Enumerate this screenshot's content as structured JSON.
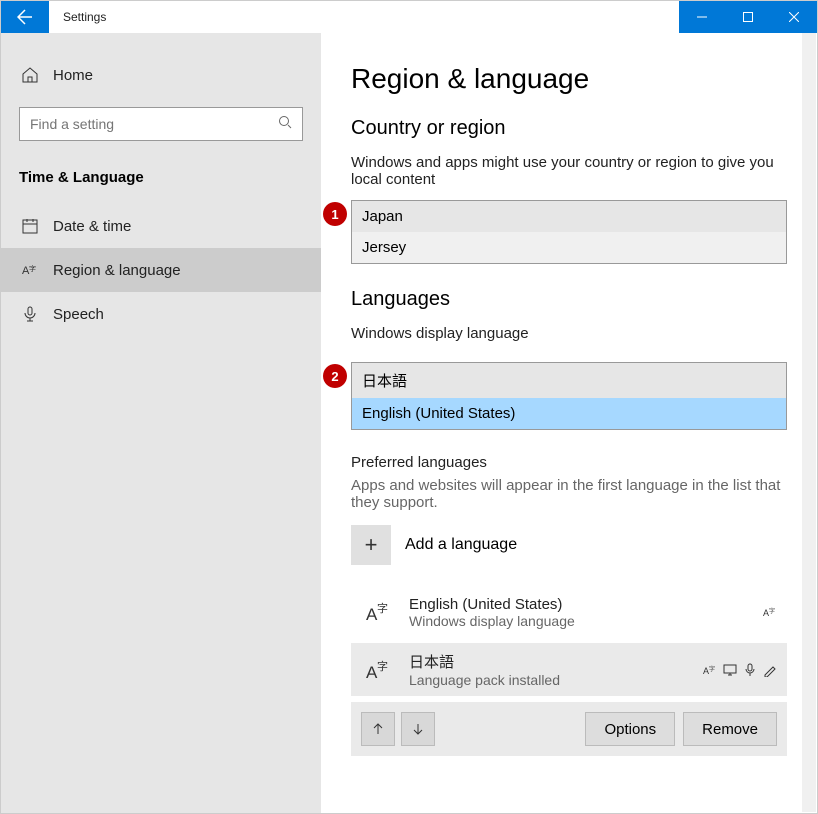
{
  "titlebar": {
    "title": "Settings"
  },
  "sidebar": {
    "home": "Home",
    "search_placeholder": "Find a setting",
    "section": "Time & Language",
    "items": [
      {
        "label": "Date & time"
      },
      {
        "label": "Region & language"
      },
      {
        "label": "Speech"
      }
    ]
  },
  "main": {
    "title": "Region & language",
    "region_heading": "Country or region",
    "region_desc": "Windows and apps might use your country or region to give you local content",
    "region_dropdown": {
      "selected": "Japan",
      "other": "Jersey",
      "callout": "1"
    },
    "lang_heading": "Languages",
    "display_subhead": "Windows display language",
    "display_dropdown": {
      "selected": "日本語",
      "highlight": "English (United States)",
      "callout": "2"
    },
    "pref_heading": "Preferred languages",
    "pref_desc": "Apps and websites will appear in the first language in the list that they support.",
    "add_label": "Add a language",
    "lang1": {
      "name": "English (United States)",
      "sub": "Windows display language"
    },
    "lang2": {
      "name": "日本語",
      "sub": "Language pack installed"
    },
    "btn_options": "Options",
    "btn_remove": "Remove"
  }
}
